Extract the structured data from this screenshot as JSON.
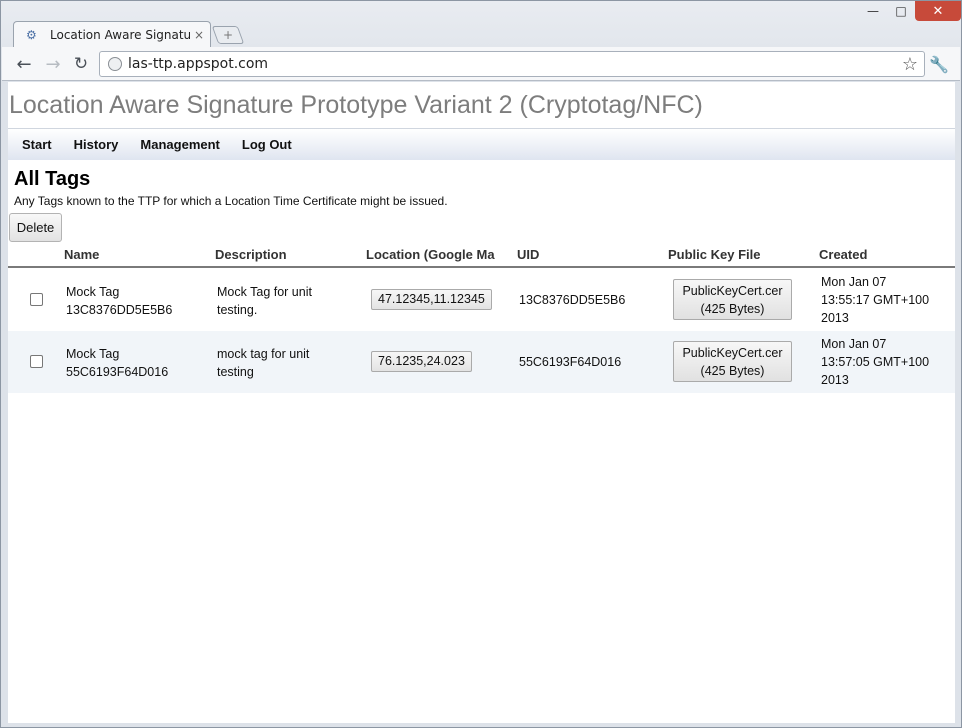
{
  "browser": {
    "tab_title": "Location Aware Signatur...",
    "tab_close": "×",
    "new_tab": "+",
    "url": "las-ttp.appspot.com",
    "window_min": "—",
    "window_max": "□",
    "window_close": "✕"
  },
  "app": {
    "title": "Location Aware Signature Prototype Variant 2 (Cryptotag/NFC)"
  },
  "menu": [
    {
      "label": "Start"
    },
    {
      "label": "History"
    },
    {
      "label": "Management"
    },
    {
      "label": "Log Out"
    }
  ],
  "section": {
    "title": "All Tags",
    "description": "Any Tags known to the TTP for which a Location Time Certificate might be issued.",
    "delete_label": "Delete"
  },
  "table": {
    "columns": [
      "Name",
      "Description",
      "Location (Google Ma",
      "UID",
      "Public Key File",
      "Created"
    ],
    "rows": [
      {
        "name_line1": "Mock Tag",
        "name_line2": "13C8376DD5E5B6",
        "desc_line1": "Mock Tag for unit",
        "desc_line2": "testing.",
        "location": "47.12345,11.12345",
        "uid": "13C8376DD5E5B6",
        "key_file": "PublicKeyCert.cer",
        "key_size": "(425 Bytes)",
        "created_line1": "Mon Jan 07",
        "created_line2": "13:55:17 GMT+100",
        "created_line3": "2013"
      },
      {
        "name_line1": "Mock Tag",
        "name_line2": "55C6193F64D016",
        "desc_line1": "mock tag for unit",
        "desc_line2": "testing",
        "location": "76.1235,24.023",
        "uid": "55C6193F64D016",
        "key_file": "PublicKeyCert.cer",
        "key_size": "(425 Bytes)",
        "created_line1": "Mon Jan 07",
        "created_line2": "13:57:05 GMT+100",
        "created_line3": "2013"
      }
    ]
  }
}
